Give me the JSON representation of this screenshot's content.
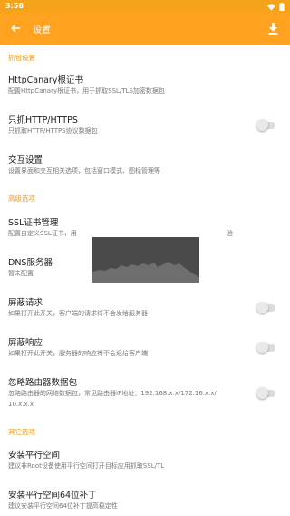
{
  "status_bar": {
    "time": "3:58",
    "wifi_icon": "wifi-icon",
    "battery_icon": "battery-icon"
  },
  "toolbar": {
    "title": "设置",
    "back_icon": "arrow-left-icon",
    "download_icon": "download-icon"
  },
  "sections": {
    "capture": {
      "header": "抓包设置"
    },
    "advanced": {
      "header": "高级选项"
    },
    "other": {
      "header": "其它选项"
    }
  },
  "items": {
    "root_cert": {
      "title": "HttpCanary根证书",
      "subtitle": "配置HttpCanary根证书，用于抓取SSL/TLS加密数据包"
    },
    "http_only": {
      "title": "只抓HTTP/HTTPS",
      "subtitle": "只抓取HTTP/HTTPS协议数据包",
      "enabled": false
    },
    "interaction": {
      "title": "交互设置",
      "subtitle": "设置界面和交互相关选项，包括窗口模式、图标管理等"
    },
    "ssl_cert": {
      "title": "SSL证书管理",
      "subtitle_left": "配置自定义SSL证书，用",
      "subtitle_right": "验"
    },
    "dns": {
      "title": "DNS服务器",
      "subtitle": "暂未配置"
    },
    "block_request": {
      "title": "屏蔽请求",
      "subtitle": "如果打开此开关，客户端的请求将不会发给服务器",
      "enabled": false
    },
    "block_response": {
      "title": "屏蔽响应",
      "subtitle": "如果打开此开关，服务器的响应将不会返给客户端",
      "enabled": false
    },
    "ignore_router": {
      "title": "忽略路由器数据包",
      "subtitle_line1": "忽略路由器的网络数据包，常见路由器IP地址：192.168.x.x/172.16.x.x/",
      "subtitle_line2": "10.x.x.x",
      "enabled": false
    },
    "parallel_space": {
      "title": "安装平行空间",
      "subtitle": "建议非Root设备使用平行空间打开目标应用抓取SSL/TL"
    },
    "parallel_space_64": {
      "title": "安装平行空间64位补丁",
      "subtitle": "建议安装平行空间64位补丁提高稳定性"
    }
  },
  "colors": {
    "accent": "#ffa21f",
    "section_header": "#f39a14"
  }
}
